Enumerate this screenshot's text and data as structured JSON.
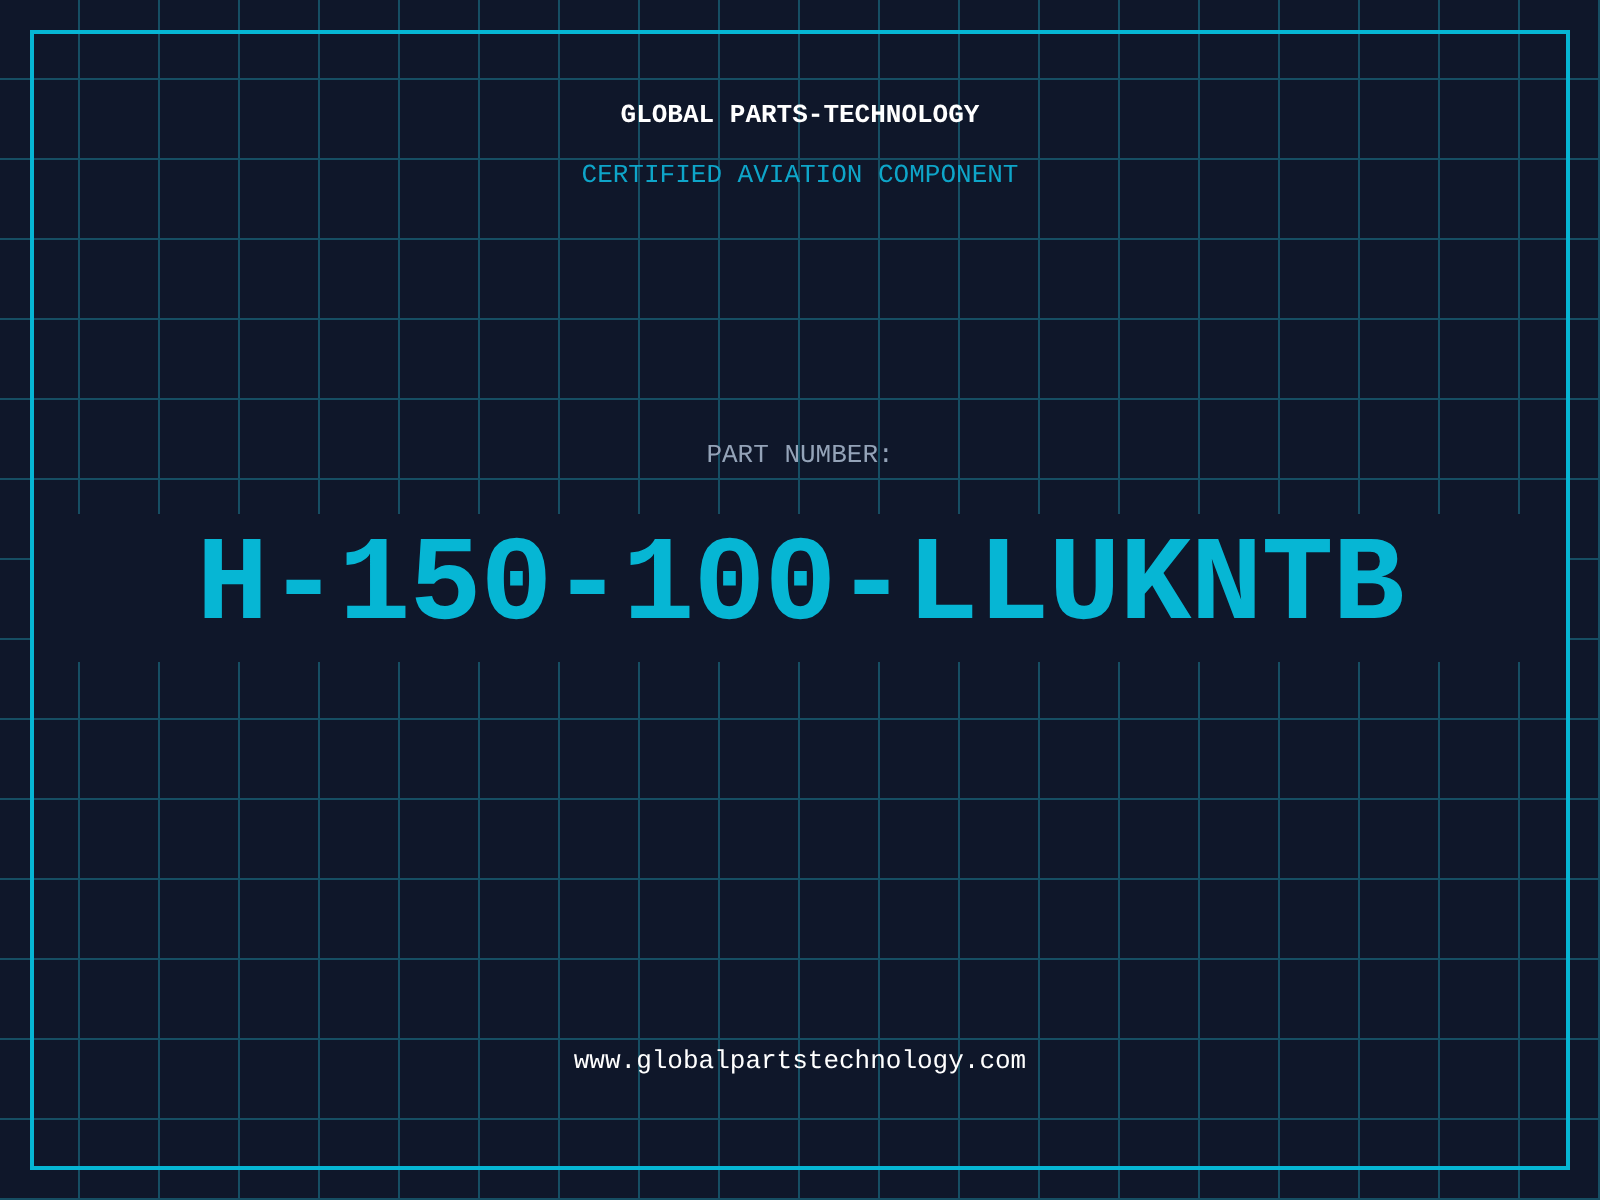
{
  "company": "GLOBAL PARTS-TECHNOLOGY",
  "tagline": "CERTIFIED AVIATION COMPONENT",
  "part_label": "PART NUMBER:",
  "part_number": "H-150-100-LLUKNTB",
  "website": "www.globalpartstechnology.com"
}
